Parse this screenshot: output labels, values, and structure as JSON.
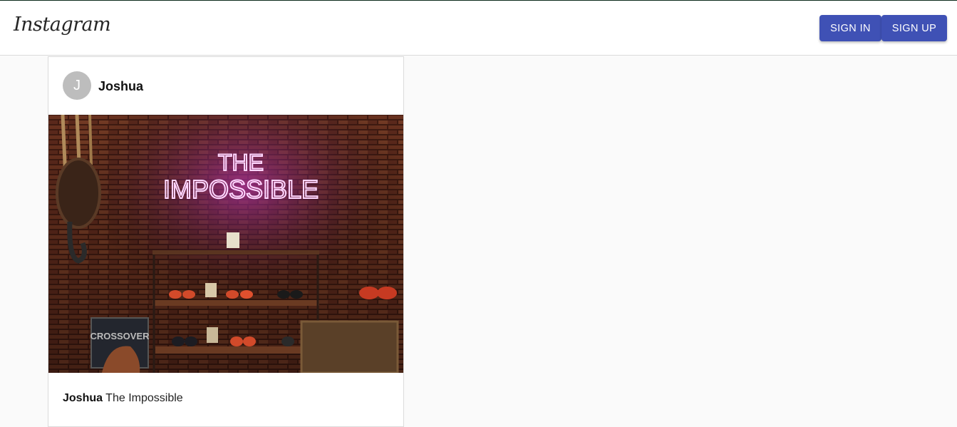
{
  "header": {
    "logo": "Instagram",
    "sign_in_label": "SIGN IN",
    "sign_up_label": "SIGN UP",
    "button_color": "#3f51b5"
  },
  "post": {
    "avatar_initial": "J",
    "username": "Joshua",
    "image_neon_text_top": "THE",
    "image_neon_text_bottom": "IMPOSSIBLE",
    "image_sign_text": "CROSSOVER",
    "caption_user": "Joshua",
    "caption_text": "The Impossible"
  }
}
